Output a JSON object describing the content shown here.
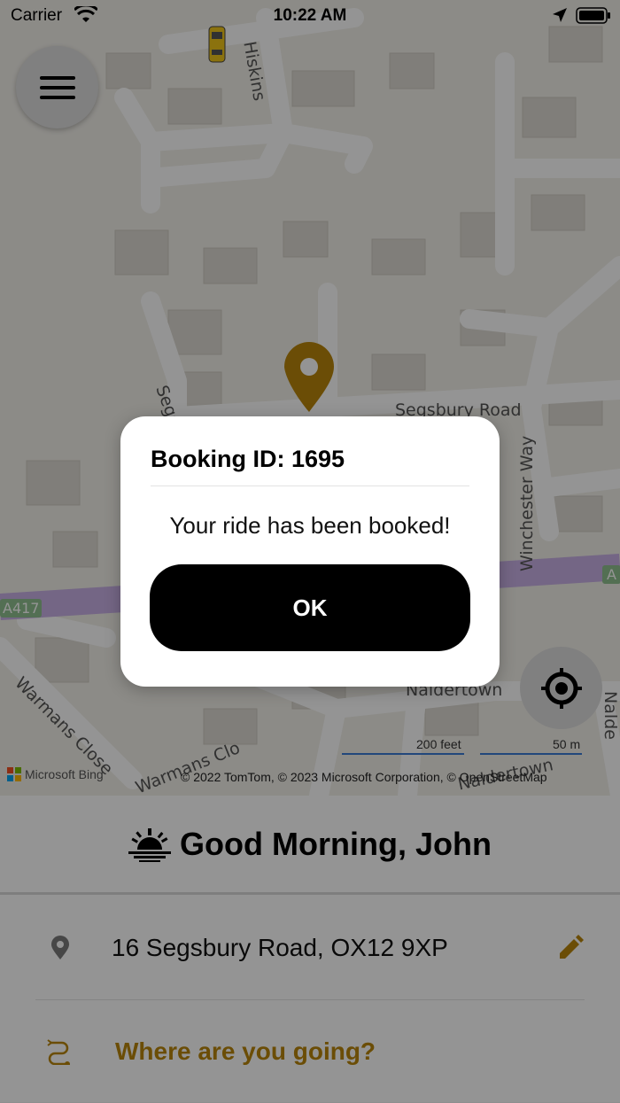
{
  "status_bar": {
    "carrier": "Carrier",
    "time": "10:22 AM"
  },
  "map": {
    "street_labels": [
      "Hiskins",
      "Segsbury Road",
      "Segs",
      "Winchester Way",
      "Naldertown",
      "Nalde",
      "Warmans Close",
      "Warmans Clo",
      "Naldertown",
      "A417",
      "A"
    ],
    "scale_feet": "200 feet",
    "scale_m": "50 m",
    "attribution": "© 2022 TomTom, © 2023 Microsoft Corporation, © OpenStreetMap",
    "provider": "Microsoft Bing",
    "colors": {
      "pin": "#b8860b",
      "taxi": "#f0c419",
      "road_major": "#c8b0e6"
    }
  },
  "panel": {
    "greeting": "Good Morning, John",
    "pickup_address": "16 Segsbury Road, OX12 9XP",
    "destination_placeholder": "Where are you going?",
    "accent": "#b8860b"
  },
  "dialog": {
    "title": "Booking ID: 1695",
    "message": "Your ride has been booked!",
    "ok_label": "OK"
  },
  "icons": [
    "menu-icon",
    "locate-icon",
    "map-pin-icon",
    "taxi-icon",
    "sunrise-icon",
    "location-pin-icon",
    "edit-pencil-icon",
    "route-icon",
    "wifi-icon",
    "location-arrow-icon",
    "battery-icon",
    "microsoft-logo-icon"
  ]
}
